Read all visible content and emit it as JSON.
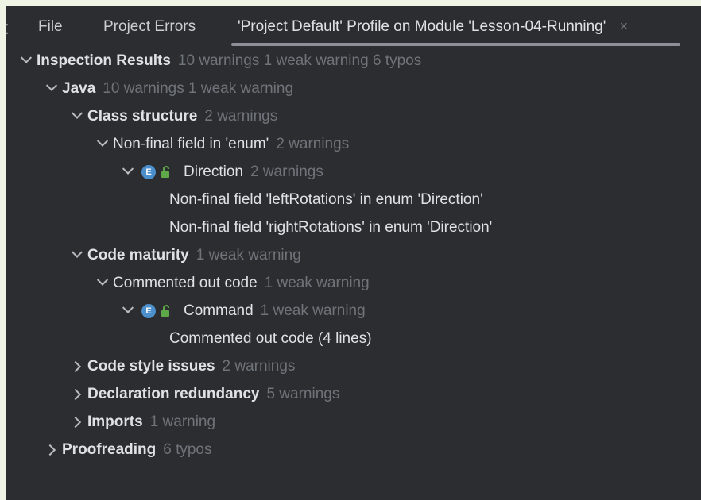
{
  "tabs": {
    "file": "File",
    "errors": "Project Errors",
    "profile": "'Project Default' Profile on Module 'Lesson-04-Running'",
    "close_glyph": "×"
  },
  "tree": {
    "root": {
      "label": "Inspection Results",
      "count": "10 warnings 1 weak warning 6 typos"
    },
    "java": {
      "label": "Java",
      "count": "10 warnings 1 weak warning"
    },
    "class_structure": {
      "label": "Class structure",
      "count": "2 warnings"
    },
    "nonfinal_enum": {
      "label": "Non-final field in 'enum'",
      "count": "2 warnings"
    },
    "direction": {
      "label": "Direction",
      "count": "2 warnings",
      "icon_letter": "E"
    },
    "problem_left": {
      "label": "Non-final field 'leftRotations' in enum 'Direction'"
    },
    "problem_right": {
      "label": "Non-final field 'rightRotations' in enum 'Direction'"
    },
    "code_maturity": {
      "label": "Code maturity",
      "count": "1 weak warning"
    },
    "commented_code": {
      "label": "Commented out code",
      "count": "1 weak warning"
    },
    "command": {
      "label": "Command",
      "count": "1 weak warning",
      "icon_letter": "E"
    },
    "problem_commented": {
      "label": "Commented out code (4 lines)"
    },
    "code_style": {
      "label": "Code style issues",
      "count": "2 warnings"
    },
    "declaration": {
      "label": "Declaration redundancy",
      "count": "5 warnings"
    },
    "imports": {
      "label": "Imports",
      "count": "1 warning"
    },
    "proofreading": {
      "label": "Proofreading",
      "count": "6 typos"
    }
  },
  "colors": {
    "background": "#2b2d30",
    "text": "#dfe1e5",
    "count_text": "#6f737a",
    "enum_icon": "#4b8fcc",
    "lock_icon": "#5fa84a"
  },
  "icons": [
    "chevron-down-icon",
    "chevron-right-icon",
    "enum-icon",
    "unlocked-icon",
    "close-icon"
  ]
}
